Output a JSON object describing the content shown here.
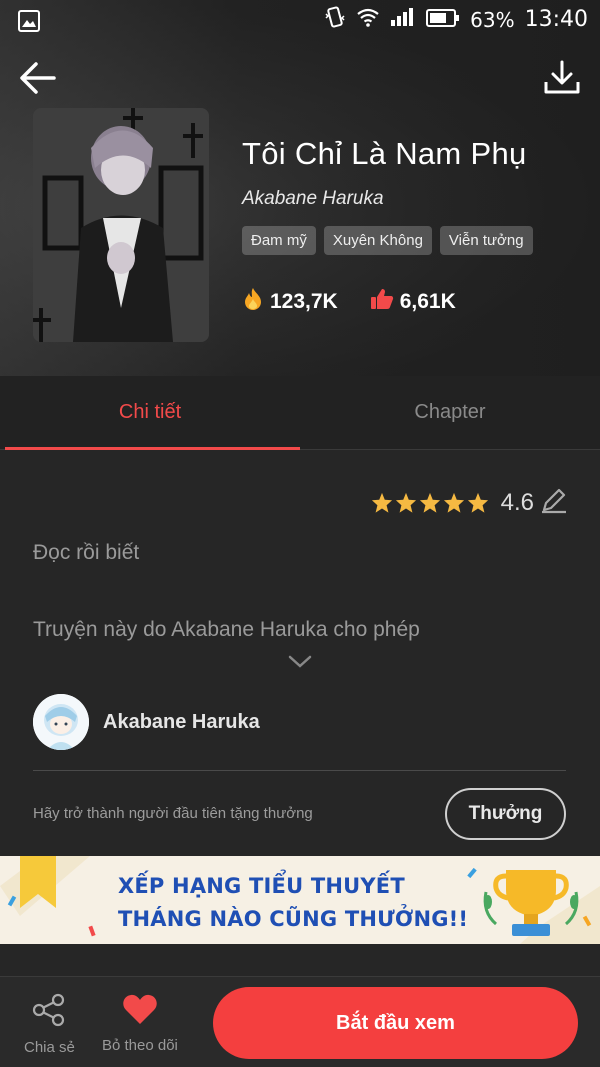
{
  "status_bar": {
    "battery": "63%",
    "time": "13:40"
  },
  "book": {
    "title": "Tôi Chỉ Là Nam Phụ",
    "author": "Akabane Haruka",
    "tags": [
      "Đam mỹ",
      "Xuyên Không",
      "Viễn tưởng"
    ],
    "views": "123,7K",
    "likes": "6,61K"
  },
  "tabs": [
    {
      "label": "Chi tiết",
      "active": true
    },
    {
      "label": "Chapter",
      "active": false
    }
  ],
  "detail": {
    "rating": "4.6",
    "stars": 5,
    "description": "Đọc rồi biết",
    "permission": "Truyện này do Akabane Haruka cho phép",
    "author_name": "Akabane Haruka",
    "reward_prompt": "Hãy trở thành người đầu tiên tặng thưởng",
    "reward_button": "Thưởng"
  },
  "banner": {
    "line1": "XẾP HẠNG TIỂU THUYẾT",
    "line2": "THÁNG NÀO CŨNG THƯỞNG!!"
  },
  "bottom_bar": {
    "share_label": "Chia sẻ",
    "follow_label": "Bỏ theo dõi",
    "start_label": "Bắt đầu xem"
  },
  "colors": {
    "accent": "#f43f3f",
    "active_tab": "#f24a4a",
    "banner_text": "#1f4fb4",
    "star": "#f5b942"
  },
  "icons": [
    "gallery-icon",
    "vibrate-icon",
    "wifi-icon",
    "signal-icon",
    "battery-icon",
    "back-arrow-icon",
    "download-icon",
    "fire-icon",
    "thumbs-up-icon",
    "star-icon",
    "edit-pencil-icon",
    "chevron-down-icon",
    "share-icon",
    "heart-icon",
    "trophy-icon",
    "bookmark-ribbon-icon"
  ]
}
